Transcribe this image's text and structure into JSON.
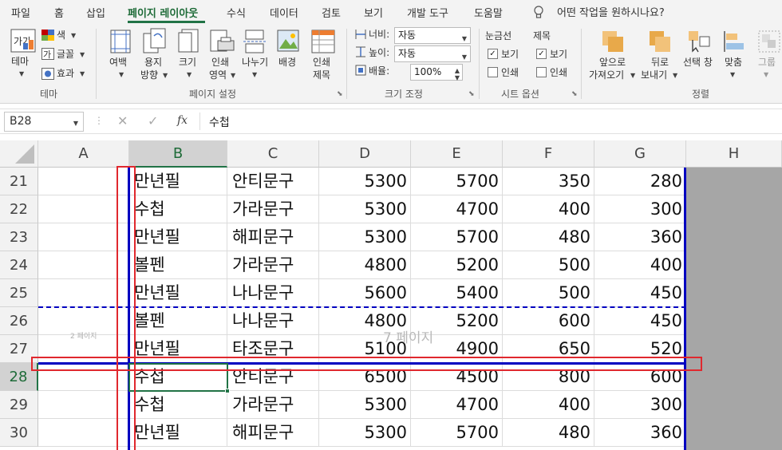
{
  "ribbon_tabs": [
    "파일",
    "홈",
    "삽입",
    "페이지 레이아웃",
    "수식",
    "데이터",
    "검토",
    "보기",
    "개발 도구",
    "도움말"
  ],
  "tell_me": "어떤 작업을 원하시나요?",
  "ribbon": {
    "theme": {
      "themes_l1": "테마",
      "colors": "색",
      "fonts": "글꼴",
      "effects": "효과",
      "group": "테마"
    },
    "page_setup": {
      "margins": "여백",
      "orientation_l1": "용지",
      "orientation_l2": "방향",
      "size": "크기",
      "print_area_l1": "인쇄",
      "print_area_l2": "영역",
      "breaks": "나누기",
      "background": "배경",
      "print_titles_l1": "인쇄",
      "print_titles_l2": "제목",
      "group": "페이지 설정"
    },
    "scale": {
      "width_label": "너비:",
      "width_value": "자동",
      "height_label": "높이:",
      "height_value": "자동",
      "scale_label": "배율:",
      "scale_value": "100%",
      "group": "크기 조정"
    },
    "sheet_options": {
      "gridlines": "눈금선",
      "headings": "제목",
      "view": "보기",
      "print": "인쇄",
      "group": "시트 옵션"
    },
    "arrange": {
      "bring_forward_l1": "앞으로",
      "bring_forward_l2": "가져오기",
      "send_backward_l1": "뒤로",
      "send_backward_l2": "보내기",
      "selection_pane": "선택 창",
      "align": "맞춤",
      "group_btn": "그룹",
      "group": "정렬"
    }
  },
  "formula_bar": {
    "name_box": "B28",
    "fx": "fx",
    "content": "수첩"
  },
  "columns": [
    "A",
    "B",
    "C",
    "D",
    "E",
    "F",
    "G",
    "H"
  ],
  "rows": [
    {
      "num": "21",
      "b": "만년필",
      "c": "안티문구",
      "d": "5300",
      "e": "5700",
      "f": "350",
      "g": "280"
    },
    {
      "num": "22",
      "b": "수첩",
      "c": "가라문구",
      "d": "5300",
      "e": "4700",
      "f": "400",
      "g": "300"
    },
    {
      "num": "23",
      "b": "만년필",
      "c": "해피문구",
      "d": "5300",
      "e": "5700",
      "f": "480",
      "g": "360"
    },
    {
      "num": "24",
      "b": "볼펜",
      "c": "가라문구",
      "d": "4800",
      "e": "5200",
      "f": "500",
      "g": "400"
    },
    {
      "num": "25",
      "b": "만년필",
      "c": "나나문구",
      "d": "5600",
      "e": "5400",
      "f": "500",
      "g": "450"
    },
    {
      "num": "26",
      "b": "볼펜",
      "c": "나나문구",
      "d": "4800",
      "e": "5200",
      "f": "600",
      "g": "450"
    },
    {
      "num": "27",
      "b": "만년필",
      "c": "타조문구",
      "d": "5100",
      "e": "4900",
      "f": "650",
      "g": "520"
    },
    {
      "num": "28",
      "b": "수첩",
      "c": "안티문구",
      "d": "6500",
      "e": "4500",
      "f": "800",
      "g": "600"
    },
    {
      "num": "29",
      "b": "수첩",
      "c": "가라문구",
      "d": "5300",
      "e": "4700",
      "f": "400",
      "g": "300"
    },
    {
      "num": "30",
      "b": "만년필",
      "c": "해피문구",
      "d": "5300",
      "e": "5700",
      "f": "480",
      "g": "360"
    }
  ],
  "watermarks": {
    "page2": "2 페이지",
    "page7": "7 페이지"
  },
  "colors": {
    "accent": "#217346",
    "page_break": "#0000c0",
    "highlight": "#e0282e"
  }
}
